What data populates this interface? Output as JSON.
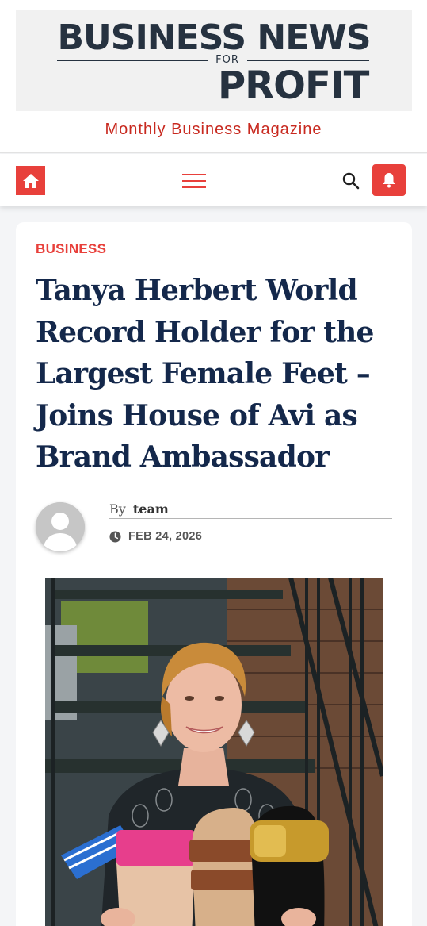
{
  "site": {
    "logo_line1": "BUSINESS NEWS",
    "logo_for": "FOR",
    "logo_line2": "PROFIT",
    "tagline": "Monthly Business Magazine"
  },
  "nav": {
    "home_icon": "home-icon",
    "menu_icon": "hamburger-menu-icon",
    "search_icon": "search-icon",
    "bell_icon": "bell-icon",
    "accent_color": "#e8403b"
  },
  "article": {
    "category": "BUSINESS",
    "title": "Tanya Herbert World Record Holder for the Largest Female Feet – Joins House of Avi as Brand Ambassador",
    "by_label": "By",
    "author": "team",
    "date": "FEB 24, 2026"
  },
  "colors": {
    "title": "#14284b",
    "tagline": "#c8291f",
    "logo": "#263240"
  }
}
